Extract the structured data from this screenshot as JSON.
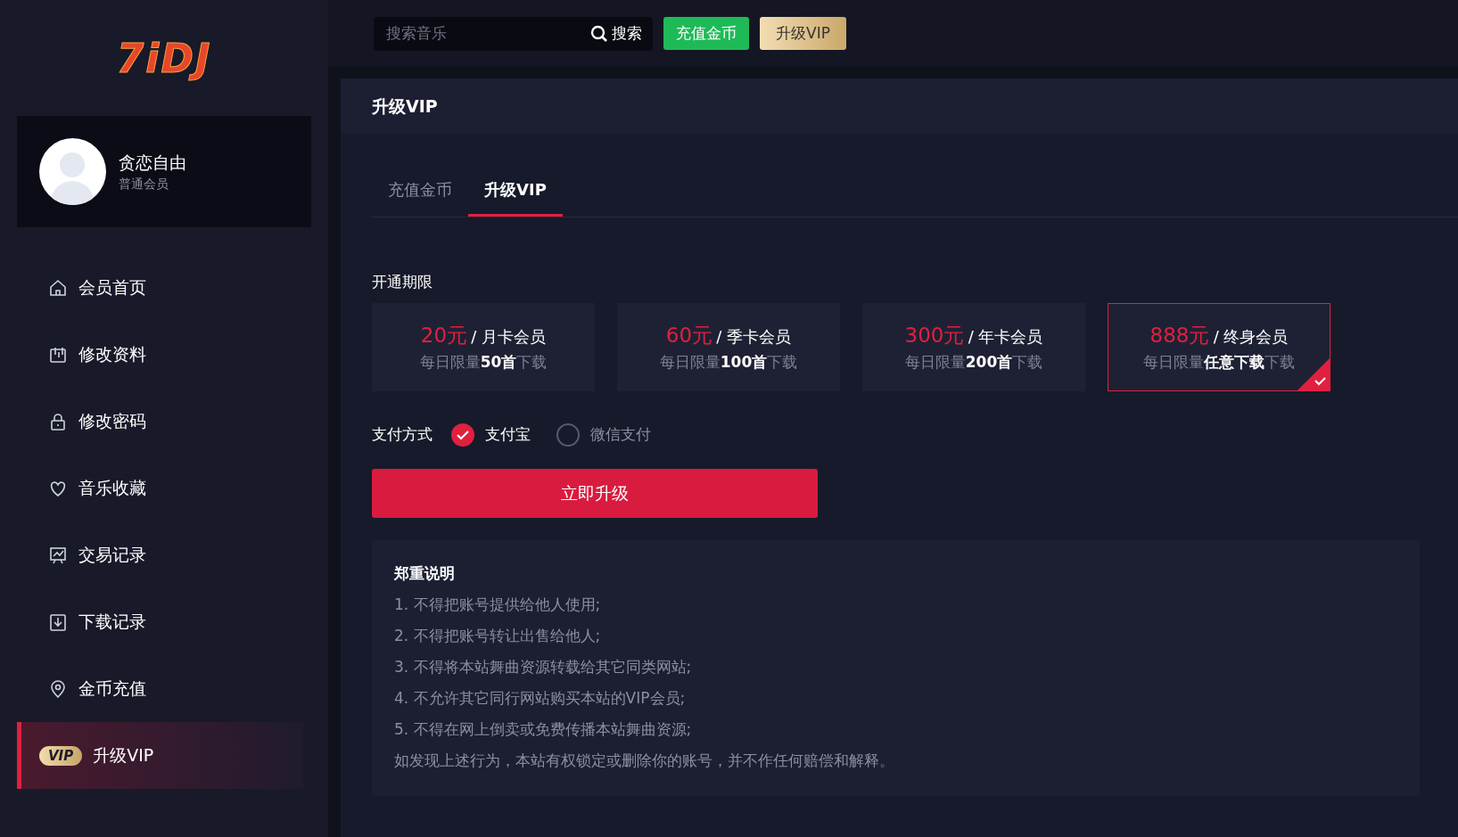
{
  "logo": {
    "text": "7iDJ"
  },
  "search": {
    "placeholder": "搜索音乐",
    "button": "搜索"
  },
  "top_buttons": [
    {
      "label": "充值金币",
      "kind": "recharge"
    },
    {
      "label": "升级VIP",
      "kind": "vip"
    }
  ],
  "user": {
    "name": "贪恋自由",
    "level": "普通会员"
  },
  "sidebar": {
    "items": [
      {
        "label": "会员首页",
        "kind": "home",
        "selected": false
      },
      {
        "label": "修改资料",
        "kind": "edit",
        "selected": false
      },
      {
        "label": "修改密码",
        "kind": "lock",
        "selected": false
      },
      {
        "label": "音乐收藏",
        "kind": "heart",
        "selected": false
      },
      {
        "label": "交易记录",
        "kind": "chart",
        "selected": false
      },
      {
        "label": "下载记录",
        "kind": "download",
        "selected": false
      },
      {
        "label": "金币充值",
        "kind": "pin",
        "selected": false
      },
      {
        "label": "升级VIP",
        "kind": "vip",
        "badge": "VIP",
        "selected": true
      }
    ]
  },
  "panel": {
    "title": "升级VIP",
    "tabs": [
      {
        "label": "充值金币",
        "selected": false
      },
      {
        "label": "升级VIP",
        "selected": true
      }
    ],
    "period_label": "开通期限",
    "plans": [
      {
        "price": "20元",
        "name": "/ 月卡会员",
        "desc": "每日限量**50首**下载",
        "selected": false
      },
      {
        "price": "60元",
        "name": "/ 季卡会员",
        "desc": "每日限量**100首**下载",
        "selected": false
      },
      {
        "price": "300元",
        "name": "/ 年卡会员",
        "desc": "每日限量**200首**下载",
        "selected": false
      },
      {
        "price": "888元",
        "name": "/ 终身会员",
        "desc": "每日限量**任意下载**下载",
        "selected": true
      }
    ],
    "payment_label": "支付方式",
    "payments": [
      {
        "label": "支付宝",
        "selected": true
      },
      {
        "label": "微信支付",
        "selected": false
      }
    ],
    "submit": "立即升级",
    "notice": {
      "title": "郑重说明",
      "lines": [
        "1. 不得把账号提供给他人使用;",
        "2. 不得把账号转让出售给他人;",
        "3. 不得将本站舞曲资源转载给其它同类网站;",
        "4. 不允许其它同行网站购买本站的VIP会员;",
        "5. 不得在网上倒卖或免费传播本站舞曲资源;",
        "如发现上述行为，本站有权锁定或删除你的账号，并不作任何赔偿和解释。"
      ]
    }
  }
}
